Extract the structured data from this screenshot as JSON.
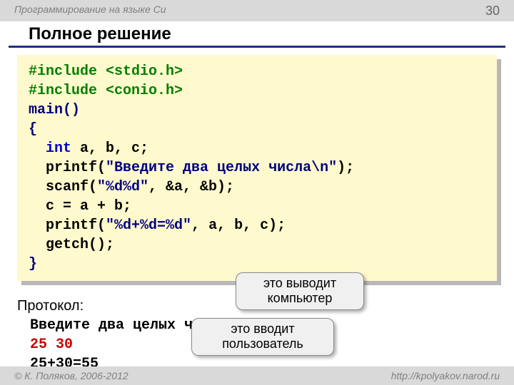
{
  "header": {
    "course": "Программирование на языке Си",
    "page_number": "30"
  },
  "title": "Полное решение",
  "code": {
    "l1a": "#include ",
    "l1b": "<stdio.h>",
    "l2a": "#include ",
    "l2b": "<conio.h>",
    "l3": "main()",
    "l4": "{",
    "l5a": "  int",
    "l5b": " a, b, c;",
    "l6a": "  printf(",
    "l6b": "\"Введите два целых числа\\n\"",
    "l6c": ");",
    "l7a": "  scanf(",
    "l7b": "\"%d%d\"",
    "l7c": ", &a, &b);",
    "l8": "  c = a + b;",
    "l9a": "  printf(",
    "l9b": "\"%d+%d=%d\"",
    "l9c": ", a, b, c);",
    "l10": "  getch();",
    "l11": "}"
  },
  "protocol": {
    "heading": "Протокол:",
    "line1": "Введите два целых числа",
    "line2": "25 30",
    "line3": "25+30=55"
  },
  "callouts": {
    "computer": "это выводит компьютер",
    "user": "это вводит пользователь"
  },
  "footer": {
    "copyright": "© К. Поляков, 2006-2012",
    "url": "http://kpolyakov.narod.ru"
  }
}
